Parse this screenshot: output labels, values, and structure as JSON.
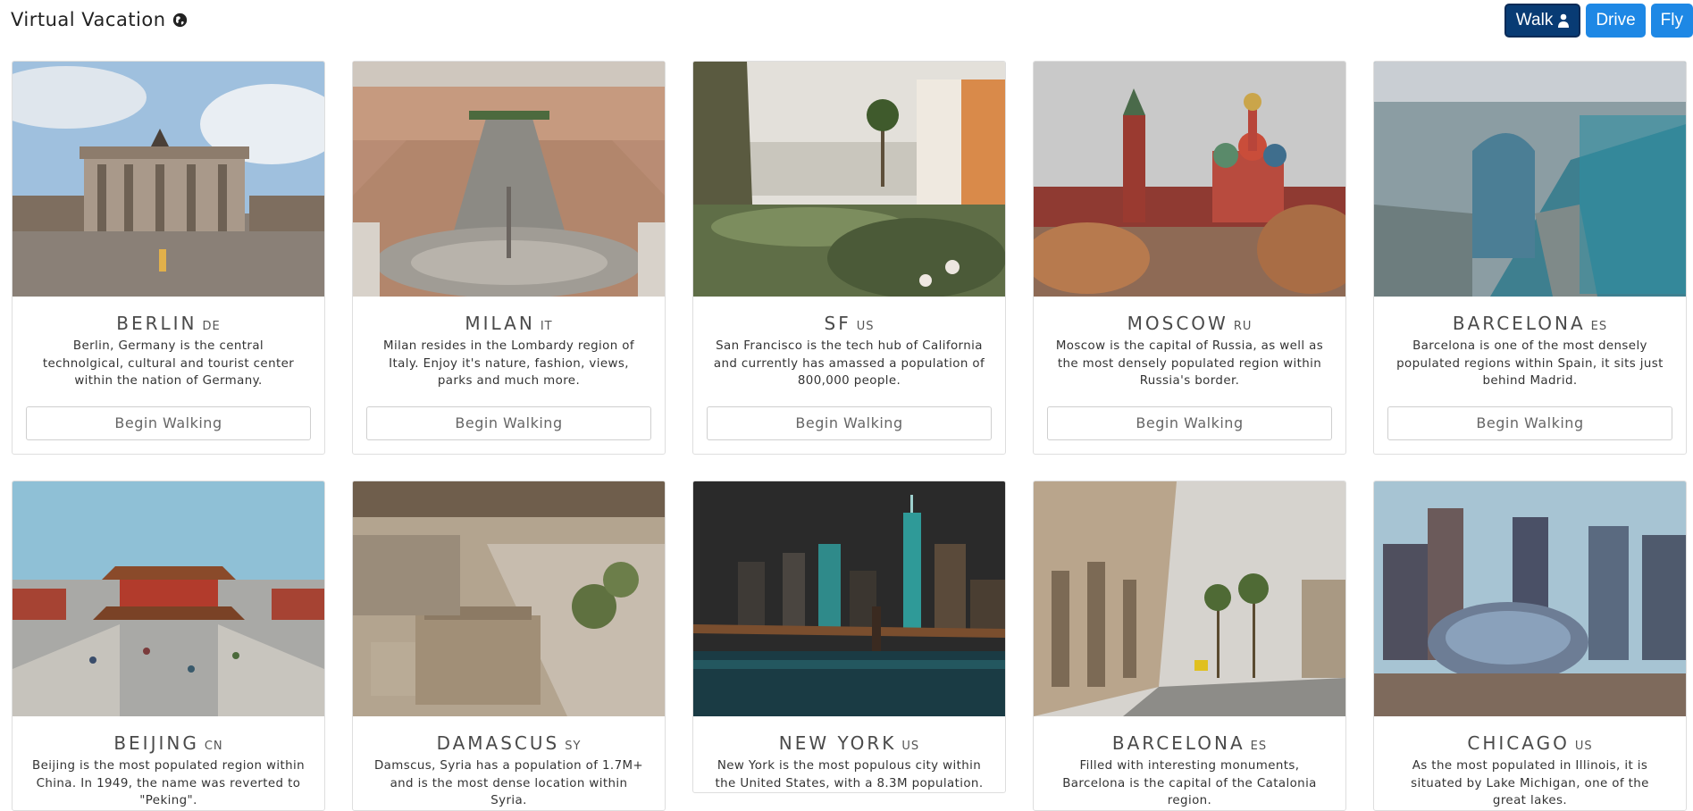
{
  "app": {
    "title": "Virtual Vacation"
  },
  "modes": [
    {
      "label": "Walk",
      "active": true
    },
    {
      "label": "Drive",
      "active": false
    },
    {
      "label": "Fly",
      "active": false
    }
  ],
  "cards": [
    {
      "city": "BERLIN",
      "country": "DE",
      "description": "Berlin, Germany is the central technolgical, cultural and tourist center within the nation of Germany.",
      "action": "Begin Walking"
    },
    {
      "city": "MILAN",
      "country": "IT",
      "description": "Milan resides in the Lombardy region of Italy. Enjoy it's nature, fashion, views, parks and much more.",
      "action": "Begin Walking"
    },
    {
      "city": "SF",
      "country": "US",
      "description": "San Francisco is the tech hub of California and currently has amassed a population of 800,000 people.",
      "action": "Begin Walking"
    },
    {
      "city": "MOSCOW",
      "country": "RU",
      "description": "Moscow is the capital of Russia, as well as the most densely populated region within Russia's border.",
      "action": "Begin Walking"
    },
    {
      "city": "BARCELONA",
      "country": "ES",
      "description": "Barcelona is one of the most densely populated regions within Spain, it sits just behind Madrid.",
      "action": "Begin Walking"
    },
    {
      "city": "BEIJING",
      "country": "CN",
      "description": "Beijing is the most populated region within China. In 1949, the name was reverted to \"Peking\".",
      "action": ""
    },
    {
      "city": "DAMASCUS",
      "country": "SY",
      "description": "Damscus, Syria has a population of 1.7M+ and is the most dense location within Syria.",
      "action": ""
    },
    {
      "city": "NEW YORK",
      "country": "US",
      "description": "New York is the most populous city within the United States, with a 8.3M population.",
      "action": ""
    },
    {
      "city": "BARCELONA",
      "country": "ES",
      "description": "Filled with interesting monuments, Barcelona is the capital of the Catalonia region.",
      "action": ""
    },
    {
      "city": "CHICAGO",
      "country": "US",
      "description": "As the most populated in Illinois, it is situated by Lake Michigan, one of the great lakes.",
      "action": ""
    }
  ],
  "colors": {
    "primary": "#1e88e5",
    "active": "#083b74"
  }
}
